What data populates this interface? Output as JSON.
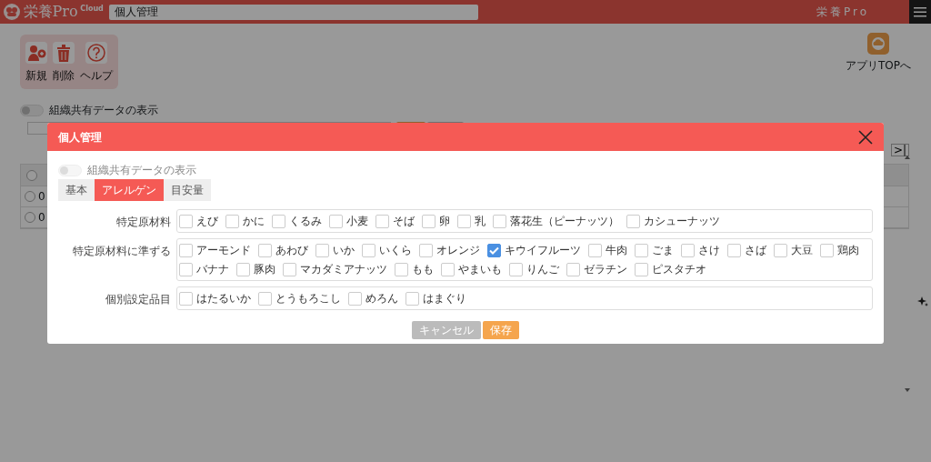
{
  "header": {
    "logo_text": "栄養Pro",
    "logo_badge": "Cloud",
    "page_title": "個人管理",
    "app_name": "栄養Pro"
  },
  "toolbar": [
    {
      "label": "新規",
      "kind": "new"
    },
    {
      "label": "削除",
      "kind": "delete"
    },
    {
      "label": "ヘルプ",
      "kind": "help"
    }
  ],
  "app_top": {
    "label": "アプリTOPへ"
  },
  "shared_toggle": {
    "label": "組織共有データの表示",
    "on": false
  },
  "pager": [
    ">|"
  ],
  "table": {
    "rows": [
      {
        "text": "0",
        "selected": false
      },
      {
        "text": "0",
        "selected": false
      }
    ]
  },
  "modal": {
    "title": "個人管理",
    "shared_toggle": {
      "label": "組織共有データの表示",
      "on": false,
      "disabled": true
    },
    "tabs": [
      {
        "label": "基本",
        "selected": false
      },
      {
        "label": "アレルゲン",
        "selected": true
      },
      {
        "label": "目安量",
        "selected": false
      }
    ],
    "groups": [
      {
        "label": "特定原材料",
        "items": [
          {
            "label": "えび",
            "checked": false
          },
          {
            "label": "かに",
            "checked": false
          },
          {
            "label": "くるみ",
            "checked": false
          },
          {
            "label": "小麦",
            "checked": false
          },
          {
            "label": "そば",
            "checked": false
          },
          {
            "label": "卵",
            "checked": false
          },
          {
            "label": "乳",
            "checked": false
          },
          {
            "label": "落花生（ピーナッツ）",
            "checked": false
          },
          {
            "label": "カシューナッツ",
            "checked": false
          }
        ]
      },
      {
        "label": "特定原材料に準ずる",
        "items": [
          {
            "label": "アーモンド",
            "checked": false
          },
          {
            "label": "あわび",
            "checked": false
          },
          {
            "label": "いか",
            "checked": false
          },
          {
            "label": "いくら",
            "checked": false
          },
          {
            "label": "オレンジ",
            "checked": false
          },
          {
            "label": "キウイフルーツ",
            "checked": true
          },
          {
            "label": "牛肉",
            "checked": false
          },
          {
            "label": "ごま",
            "checked": false
          },
          {
            "label": "さけ",
            "checked": false
          },
          {
            "label": "さば",
            "checked": false
          },
          {
            "label": "大豆",
            "checked": false
          },
          {
            "label": "鶏肉",
            "checked": false
          },
          {
            "label": "バナナ",
            "checked": false
          },
          {
            "label": "豚肉",
            "checked": false
          },
          {
            "label": "マカダミアナッツ",
            "checked": false
          },
          {
            "label": "もも",
            "checked": false
          },
          {
            "label": "やまいも",
            "checked": false
          },
          {
            "label": "りんご",
            "checked": false
          },
          {
            "label": "ゼラチン",
            "checked": false
          },
          {
            "label": "ピスタチオ",
            "checked": false
          }
        ]
      },
      {
        "label": "個別設定品目",
        "items": [
          {
            "label": "はたるいか",
            "checked": false
          },
          {
            "label": "とうもろこし",
            "checked": false
          },
          {
            "label": "めろん",
            "checked": false
          },
          {
            "label": "はまぐり",
            "checked": false
          }
        ]
      }
    ],
    "buttons": [
      {
        "label": "キャンセル",
        "kind": "cancel"
      },
      {
        "label": "保存",
        "kind": "save"
      }
    ]
  }
}
